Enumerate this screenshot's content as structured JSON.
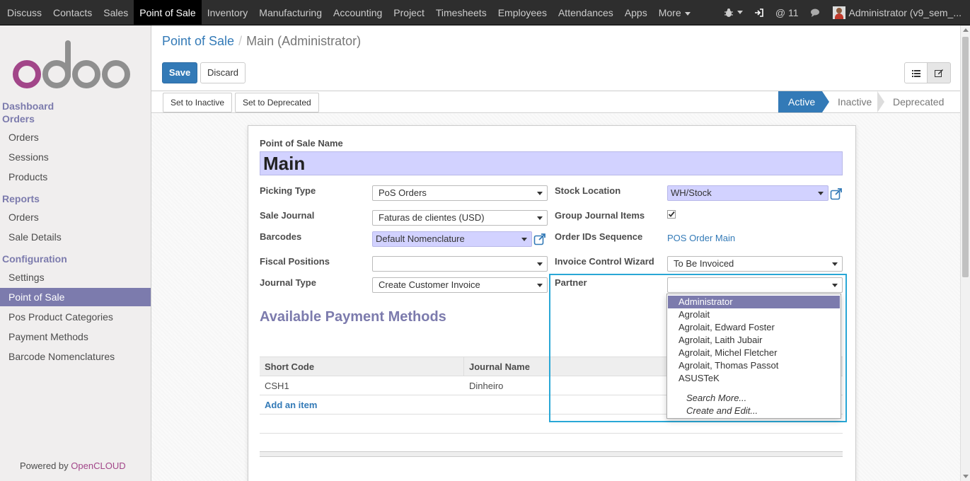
{
  "topbar": {
    "menu": [
      "Discuss",
      "Contacts",
      "Sales",
      "Point of Sale",
      "Inventory",
      "Manufacturing",
      "Accounting",
      "Project",
      "Timesheets",
      "Employees",
      "Attendances",
      "Apps",
      "More"
    ],
    "active_menu": "Point of Sale",
    "messages_count": "@ 11",
    "user": "Administrator (v9_sem_..."
  },
  "sidebar": {
    "logo": "odoo",
    "sections": {
      "dashboard": "Dashboard",
      "orders": "Orders",
      "reports": "Reports",
      "configuration": "Configuration"
    },
    "orders_items": [
      "Orders",
      "Sessions",
      "Products"
    ],
    "reports_items": [
      "Orders",
      "Sale Details"
    ],
    "config_items": [
      "Settings",
      "Point of Sale",
      "Pos Product Categories",
      "Payment Methods",
      "Barcode Nomenclatures"
    ],
    "powered_prefix": "Powered by",
    "powered_brand": "OpenCLOUD"
  },
  "breadcrumb": {
    "parent": "Point of Sale",
    "separator": "/",
    "current": "Main (Administrator)"
  },
  "buttons": {
    "save": "Save",
    "discard": "Discard"
  },
  "statusbar": {
    "set_inactive": "Set to Inactive",
    "set_deprecated": "Set to Deprecated",
    "stages": [
      "Active",
      "Inactive",
      "Deprecated"
    ]
  },
  "form": {
    "name_label": "Point of Sale Name",
    "name_value": "Main",
    "picking_type_label": "Picking Type",
    "picking_type_value": "PoS Orders",
    "sale_journal_label": "Sale Journal",
    "sale_journal_value": "Faturas de clientes (USD)",
    "barcodes_label": "Barcodes",
    "barcodes_value": "Default Nomenclature",
    "fiscal_positions_label": "Fiscal Positions",
    "fiscal_positions_value": "",
    "journal_type_label": "Journal Type",
    "journal_type_value": "Create Customer Invoice",
    "stock_location_label": "Stock Location",
    "stock_location_value": "WH/Stock",
    "group_journal_label": "Group Journal Items",
    "order_ids_label": "Order IDs Sequence",
    "order_ids_value": "POS Order Main",
    "invoice_wizard_label": "Invoice Control Wizard",
    "invoice_wizard_value": "To Be Invoiced",
    "partner_label": "Partner",
    "partner_value": ""
  },
  "payment_methods": {
    "title": "Available Payment Methods",
    "columns": [
      "Short Code",
      "Journal Name"
    ],
    "rows": [
      [
        "CSH1",
        "Dinheiro"
      ]
    ],
    "add_item": "Add an item"
  },
  "partner_dropdown": {
    "options": [
      "Administrator",
      "Agrolait",
      "Agrolait, Edward Foster",
      "Agrolait, Laith Jubair",
      "Agrolait, Michel Fletcher",
      "Agrolait, Thomas Passot",
      "ASUSTeK"
    ],
    "search_more": "Search More...",
    "create_edit": "Create and Edit..."
  },
  "colors": {
    "topbar": "#2e2e2e",
    "brand_purple": "#7c7bad",
    "primary_blue": "#337ab7",
    "required_field": "#d2d2ff",
    "focus_box": "#29a7d6"
  }
}
